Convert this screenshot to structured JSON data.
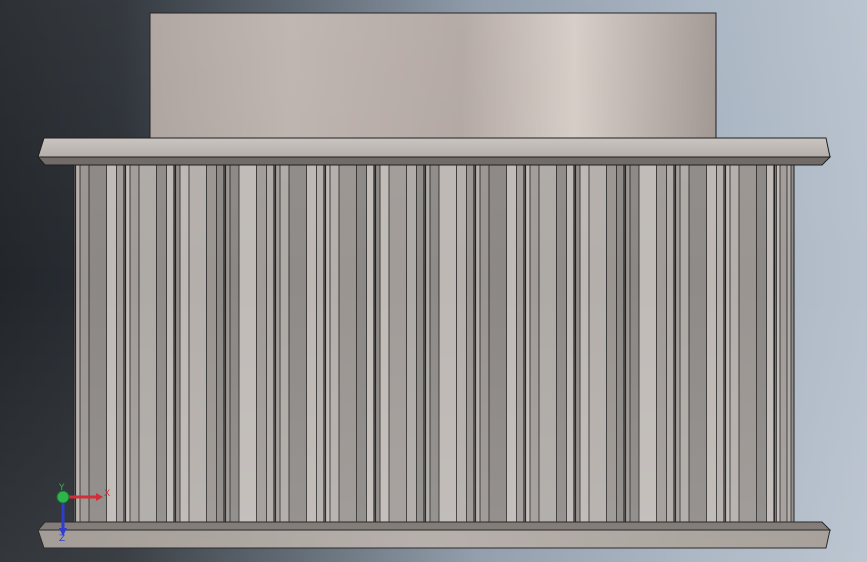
{
  "colors": {
    "edge": "#1a1a1a",
    "hub_light": "#d9d0cb",
    "hub_mid": "#b2a7a2",
    "hub_dark": "#958a86",
    "flange_light": "#c5bfbb",
    "flange_dark": "#7d7772",
    "tooth_light": "#b9b4b1",
    "tooth_dark": "#807c79",
    "axis_x": "#d0202a",
    "axis_y": "#20b040",
    "axis_z": "#1f2fcc"
  },
  "triad": {
    "x_label": "X",
    "y_label": "Y",
    "z_label": "Z"
  }
}
